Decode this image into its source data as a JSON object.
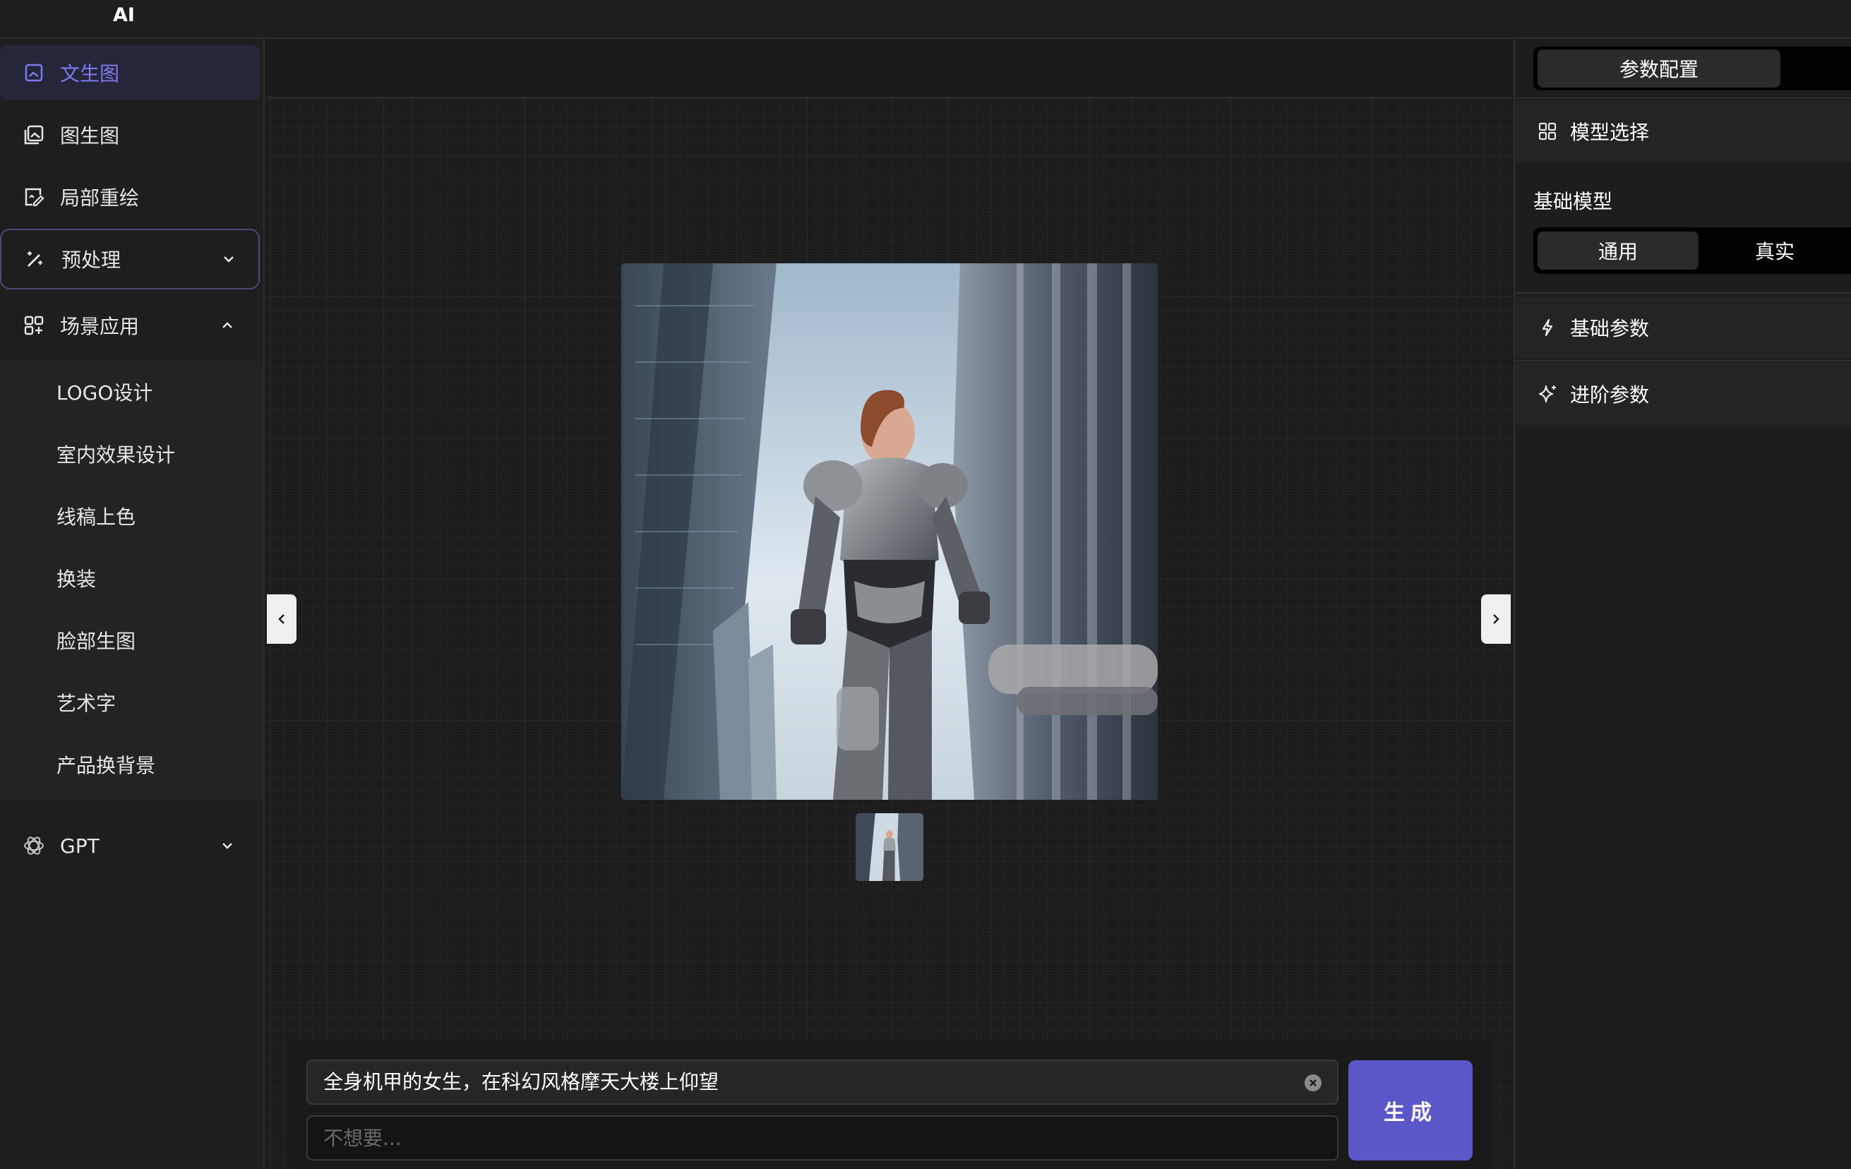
{
  "app": {
    "title": "AI"
  },
  "sidebar": {
    "items": [
      {
        "label": "文生图",
        "icon": "image-icon",
        "active": true
      },
      {
        "label": "图生图",
        "icon": "images-icon"
      },
      {
        "label": "局部重绘",
        "icon": "edit-image-icon"
      },
      {
        "label": "预处理",
        "icon": "magic-wand-icon",
        "expanded": false
      },
      {
        "label": "场景应用",
        "icon": "apps-add-icon",
        "expanded": true
      },
      {
        "label": "GPT",
        "icon": "openai-icon",
        "expanded": false
      }
    ],
    "scene_items": [
      "LOGO设计",
      "室内效果设计",
      "线稿上色",
      "换装",
      "脸部生图",
      "艺术字",
      "产品换背景"
    ]
  },
  "canvas": {
    "main_image_alt": "",
    "prompt": "全身机甲的女生，在科幻风格摩天大楼上仰望",
    "negative_placeholder": "不想要...",
    "generate_label": "生成"
  },
  "right_panel": {
    "tab": "参数配置",
    "sections": {
      "model_select": "模型选择",
      "base_model_label": "基础模型",
      "base_model_options": [
        "通用",
        "真实"
      ],
      "base_model_selected": "通用",
      "basic_params": "基础参数",
      "advanced_params": "进阶参数"
    }
  },
  "colors": {
    "accent": "#5b57c8",
    "active_text": "#7b7bf0",
    "background": "#1b1b1c"
  }
}
